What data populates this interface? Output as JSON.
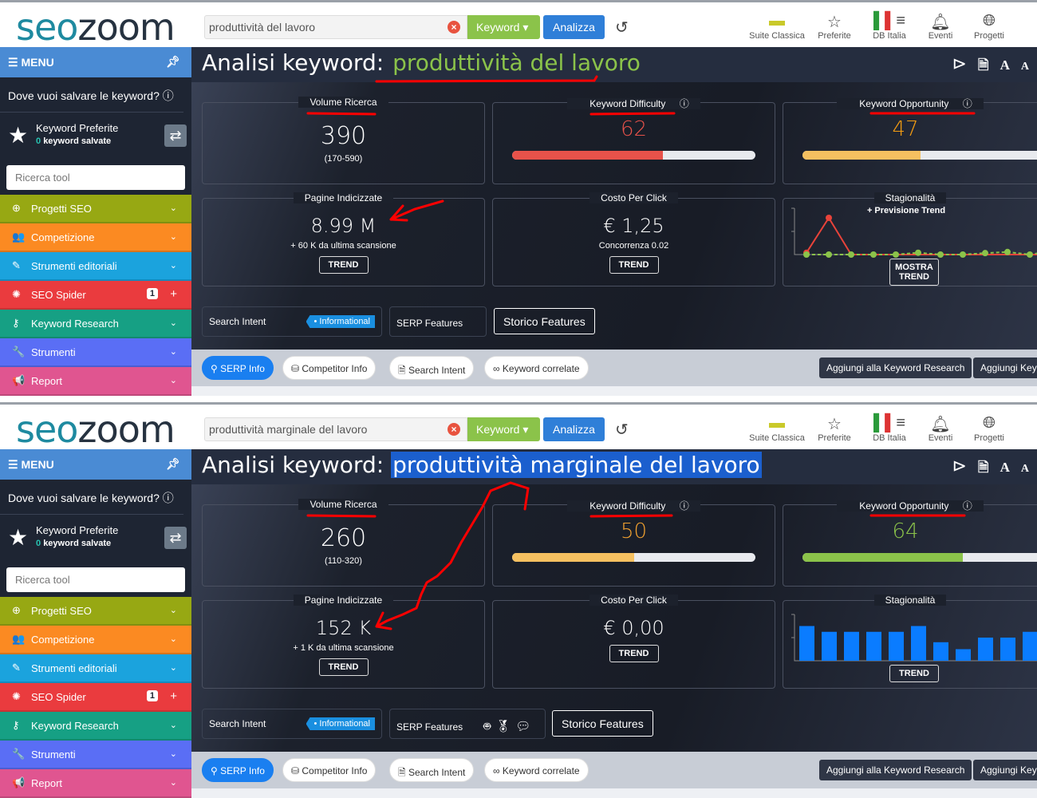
{
  "panels": [
    {
      "search_value": "produttività del lavoro",
      "keyword_selected": false,
      "keyword": "produttività del lavoro",
      "kd": {
        "value": "62",
        "percent": 62,
        "color": "#e8524a",
        "bar_color": "#e8524a"
      },
      "ko": {
        "value": "47",
        "percent": 47,
        "color": "#f39c12",
        "bar_color": "#f5c060"
      },
      "volume": {
        "value": "390",
        "range": "(170-590)"
      },
      "pages": {
        "value": "8.99 M",
        "delta": "+ 60 K da ultima scansione",
        "button": "TREND"
      },
      "cpc": {
        "value": "€ 1,25",
        "competition": "Concorrenza 0.02",
        "button": "TREND"
      },
      "season": {
        "subtitle": "+ Previsione Trend",
        "button": "MOSTRA TREND",
        "type": "line",
        "values": [
          0.05,
          1.0,
          0,
          0,
          0,
          0,
          0,
          0,
          0,
          0,
          0,
          0
        ],
        "forecast": [
          0,
          0,
          0,
          0,
          0,
          0.05,
          0,
          0,
          0.04,
          0.07,
          0,
          0.1
        ]
      },
      "serp_icons": []
    },
    {
      "search_value": "produttività marginale del lavoro",
      "keyword_selected": true,
      "keyword": "produttività marginale del lavoro",
      "kd": {
        "value": "50",
        "percent": 50,
        "color": "#f0a030",
        "bar_color": "#f5c060"
      },
      "ko": {
        "value": "64",
        "percent": 64,
        "color": "#8bc34a",
        "bar_color": "#8bc34a"
      },
      "volume": {
        "value": "260",
        "range": "(110-320)"
      },
      "pages": {
        "value": "152 K",
        "delta": "+ 1 K da ultima scansione",
        "button": "TREND"
      },
      "cpc": {
        "value": "€ 0,00",
        "competition": null,
        "button": "TREND"
      },
      "season": {
        "subtitle": null,
        "button": "TREND",
        "type": "bar",
        "values": [
          3.0,
          2.5,
          2.5,
          2.5,
          2.5,
          3.0,
          1.6,
          1.0,
          2.0,
          2.0,
          2.5,
          2.5
        ]
      },
      "serp_icons": [
        "robot-icon",
        "award-icon",
        "chat-icon"
      ]
    }
  ],
  "common": {
    "logo": "seozoom",
    "keyword_button": "Keyword ▾",
    "analyze_button": "Analizza",
    "top_icons": [
      {
        "label": "Suite Classica",
        "icon": "suite-icon"
      },
      {
        "label": "Preferite",
        "icon": "star-icon"
      },
      {
        "label": "DB Italia",
        "icon": "database-flag-icon"
      },
      {
        "label": "Eventi",
        "icon": "bell-icon"
      },
      {
        "label": "Progetti",
        "icon": "globe-icon"
      }
    ],
    "menu": "MENU",
    "save_question": "Dove vuoi salvare le keyword?",
    "fav_title": "Keyword Preferite",
    "fav_count": "0",
    "fav_saved": "keyword salvate",
    "tool_search_placeholder": "Ricerca tool",
    "sidebar": [
      {
        "label": "Progetti SEO",
        "color": "#97a813",
        "icon": "globe-icon",
        "glyph": "⊕"
      },
      {
        "label": "Competizione",
        "color": "#fb8a22",
        "icon": "users-icon",
        "glyph": "👥"
      },
      {
        "label": "Strumenti editoriali",
        "color": "#1ba3dd",
        "icon": "edit-icon",
        "glyph": "✎"
      },
      {
        "label": "SEO Spider",
        "color": "#ea3b3e",
        "icon": "spider-icon",
        "glyph": "✺",
        "badge": "1"
      },
      {
        "label": "Keyword Research",
        "color": "#16a084",
        "icon": "key-icon",
        "glyph": "⚷"
      },
      {
        "label": "Strumenti",
        "color": "#5a6ef5",
        "icon": "wrench-icon",
        "glyph": "🔧"
      },
      {
        "label": "Report",
        "color": "#e05590",
        "icon": "megaphone-icon",
        "glyph": "📢"
      }
    ],
    "title_prefix": "Analisi keyword:",
    "labels": {
      "volume": "Volume Ricerca",
      "kd": "Keyword Difficulty",
      "ko": "Keyword Opportunity",
      "pages": "Pagine Indicizzate",
      "cpc": "Costo Per Click",
      "season": "Stagionalità"
    },
    "search_intent": "Search Intent",
    "intent_tag": "• Informational",
    "serp_features": "SERP Features",
    "storico": "Storico Features",
    "pills": [
      "SERP Info",
      "Competitor Info",
      "Search Intent",
      "Keyword correlate"
    ],
    "add_kr": "Aggiungi alla Keyword Research",
    "add_kw": "Aggiungi Keyw"
  }
}
